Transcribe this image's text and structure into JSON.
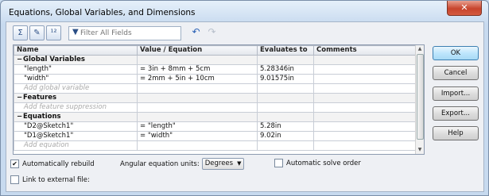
{
  "window": {
    "title": "Equations, Global Variables, and Dimensions",
    "close_glyph": "✕"
  },
  "toolbar": {
    "filter_label": "Filter All Fields",
    "filter_value": "",
    "icons": [
      "equation-view-icon",
      "sketch-view-icon",
      "ordered-view-icon",
      "filter-icon",
      "undo-icon",
      "redo-icon"
    ]
  },
  "grid": {
    "columns": [
      "Name",
      "Value / Equation",
      "Evaluates to",
      "Comments"
    ],
    "sections": [
      {
        "title": "Global Variables",
        "rows": [
          {
            "name": "\"length\"",
            "equation": "= 3in + 8mm + 5cm",
            "value": "5.28346in",
            "comment": ""
          },
          {
            "name": "\"width\"",
            "equation": "= 2mm + 5in + 10cm",
            "value": "9.01575in",
            "comment": ""
          }
        ],
        "add_placeholder": "Add global variable"
      },
      {
        "title": "Features",
        "rows": [],
        "add_placeholder": "Add feature suppression"
      },
      {
        "title": "Equations",
        "rows": [
          {
            "name": "\"D2@Sketch1\"",
            "equation": "= \"length\"",
            "value": "5.28in",
            "comment": ""
          },
          {
            "name": "\"D1@Sketch1\"",
            "equation": "= \"width\"",
            "value": "9.02in",
            "comment": ""
          }
        ],
        "add_placeholder": "Add equation"
      }
    ]
  },
  "buttons": {
    "ok": "OK",
    "cancel": "Cancel",
    "import": "Import...",
    "export": "Export...",
    "help": "Help"
  },
  "options": {
    "auto_rebuild": {
      "label": "Automatically rebuild",
      "checked": true
    },
    "angular_units": {
      "label": "Angular equation units:",
      "value": "Degrees"
    },
    "auto_solve": {
      "label": "Automatic solve order",
      "checked": false
    },
    "link_external": {
      "label": "Link to external file:",
      "checked": false
    }
  },
  "colors": {
    "titlebar": "#c9dcf0",
    "default_button": "#bee6fd",
    "close_button": "#c7442c"
  }
}
